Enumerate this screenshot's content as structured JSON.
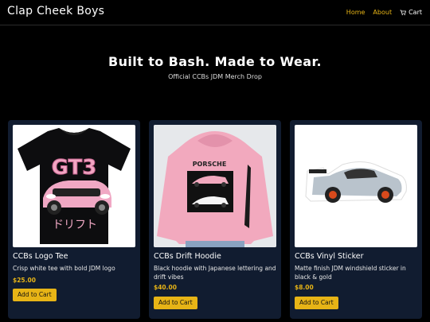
{
  "header": {
    "brand": "Clap Cheek Boys",
    "nav": {
      "home": "Home",
      "about": "About",
      "cart": "Cart"
    }
  },
  "hero": {
    "title": "Built to Bash. Made to Wear.",
    "subtitle": "Official CCBs JDM Merch Drop"
  },
  "products": [
    {
      "name": "CCBs Logo Tee",
      "description": "Crisp white tee with bold JDM logo",
      "price": "$25.00",
      "button": "Add to Cart",
      "image_text": {
        "model": "GT3",
        "script": "ドリフト"
      }
    },
    {
      "name": "CCBs Drift Hoodie",
      "description": "Black hoodie with Japanese lettering and drift vibes",
      "price": "$40.00",
      "button": "Add to Cart",
      "image_text": {
        "brand": "PORSCHE"
      }
    },
    {
      "name": "CCBs Vinyl Sticker",
      "description": "Matte finish JDM windshield sticker in black & gold",
      "price": "$8.00",
      "button": "Add to Cart"
    }
  ],
  "colors": {
    "accent": "#e7b416",
    "card_bg": "#111c30",
    "page_bg": "#000000"
  }
}
